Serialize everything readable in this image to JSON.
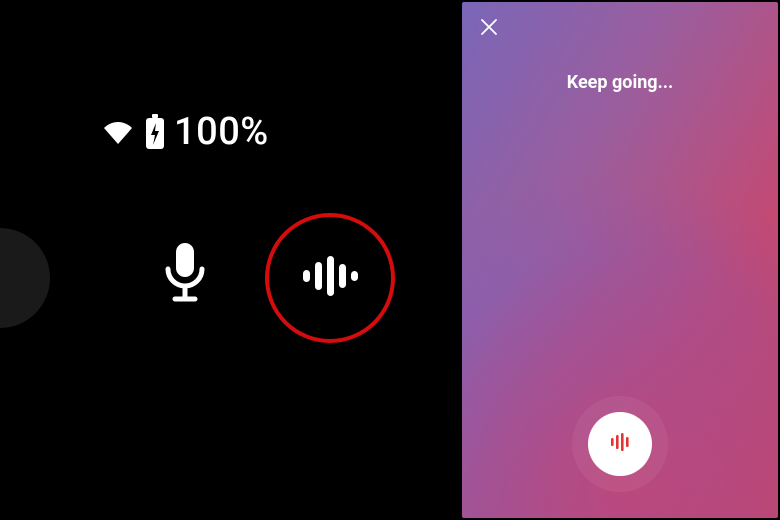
{
  "status_bar": {
    "wifi_icon": "wifi",
    "battery_icon": "battery-charging",
    "battery_percent": "100%"
  },
  "left_panel": {
    "mic_icon": "microphone",
    "identify_icon": "sound-bars",
    "highlight_color": "#d40c0c"
  },
  "listening_screen": {
    "close_icon": "close",
    "prompt": "Keep going...",
    "listen_button_icon": "sound-bars-small",
    "listen_button_color": "#e33434",
    "gradient": {
      "from": "#7a66b8",
      "mid": "#c24a74",
      "to": "#d24258"
    }
  }
}
